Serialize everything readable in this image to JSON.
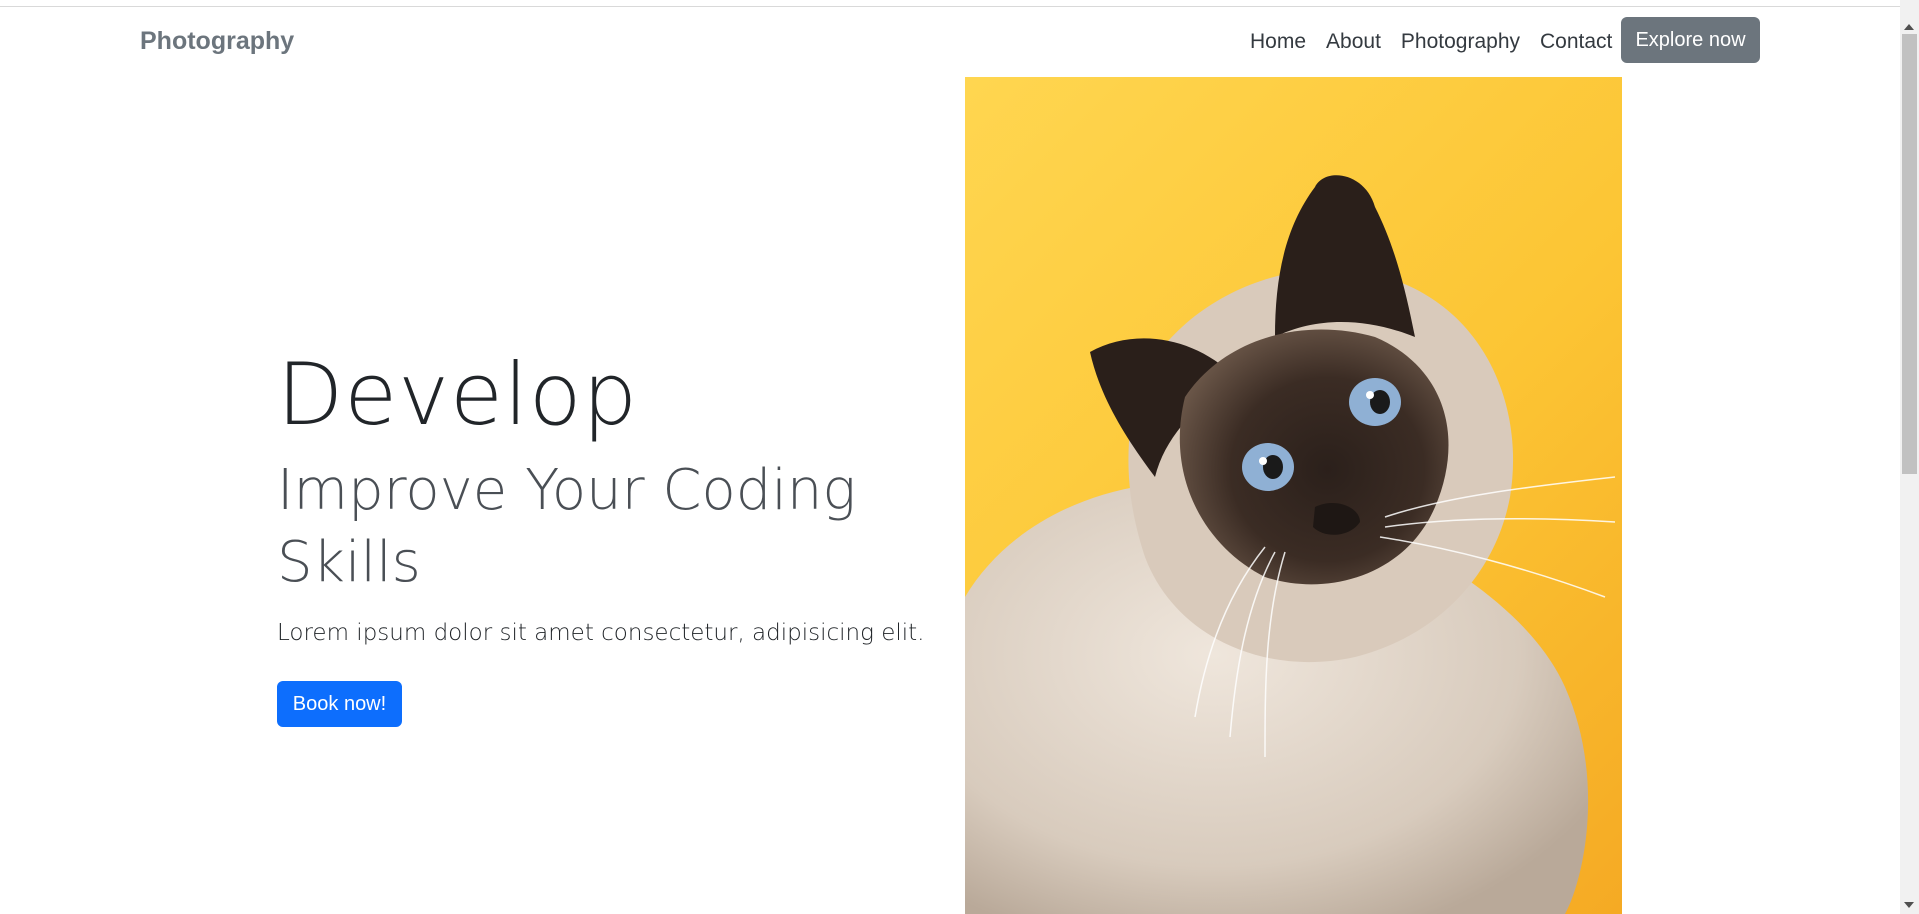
{
  "navbar": {
    "brand": "Photography",
    "links": [
      "Home",
      "About",
      "Photography",
      "Contact"
    ],
    "explore_label": "Explore now"
  },
  "hero": {
    "title": "Develop",
    "subtitle": "Improve Your Coding Skills",
    "text": "Lorem ipsum dolor sit amet consectetur, adipisicing elit.",
    "book_label": "Book now!"
  },
  "colors": {
    "brand": "#6c757d",
    "primary_button": "#0d6efd",
    "photo_background": "#fcc534"
  },
  "icons": {
    "scroll_up": "chevron-up-icon",
    "scroll_down": "chevron-down-icon"
  }
}
